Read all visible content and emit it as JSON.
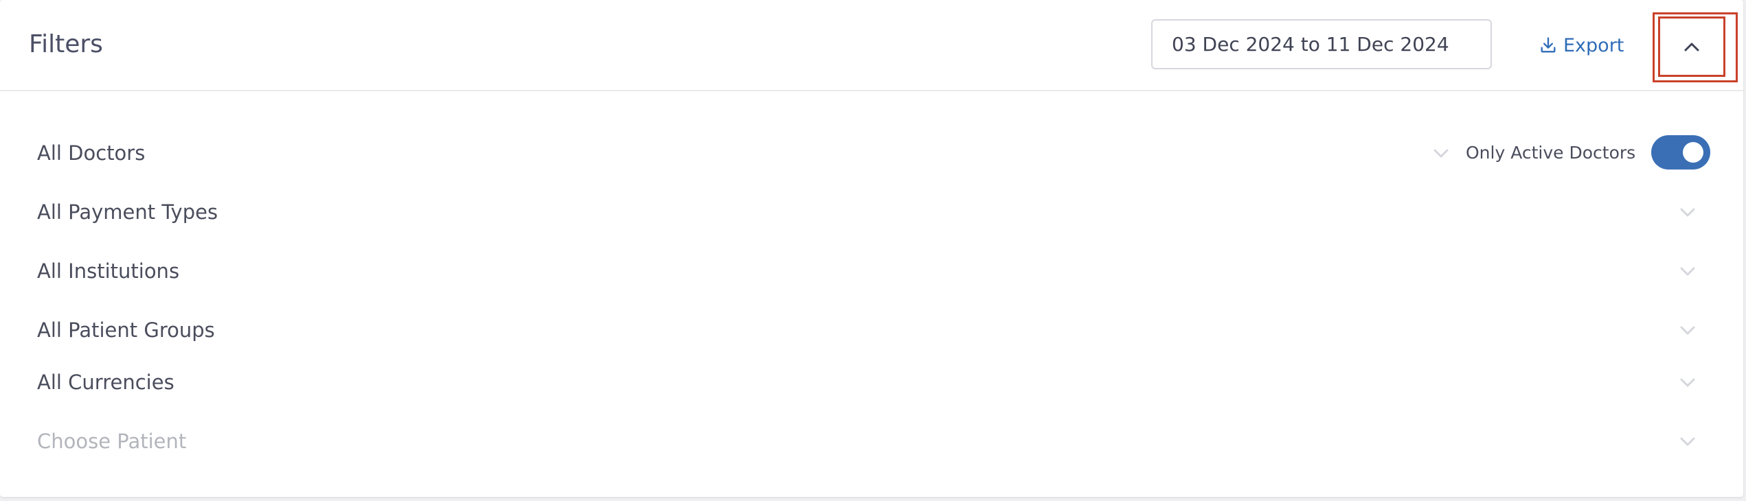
{
  "header": {
    "title": "Filters",
    "date_range": "03 Dec 2024 to 11 Dec 2024",
    "export_label": "Export",
    "collapse_icon": "chevron-up-icon"
  },
  "filters": {
    "doctors": {
      "label": "All Doctors",
      "only_active_label": "Only Active Doctors",
      "only_active_on": true
    },
    "payment_types": {
      "label": "All Payment Types"
    },
    "institutions": {
      "label": "All Institutions"
    },
    "patient_groups": {
      "label": "All Patient Groups"
    },
    "currencies": {
      "label": "All Currencies"
    },
    "patient": {
      "placeholder": "Choose Patient"
    }
  },
  "colors": {
    "accent": "#2f6cb8",
    "toggle_on": "#3a6fb5",
    "highlight": "#c9412a"
  }
}
